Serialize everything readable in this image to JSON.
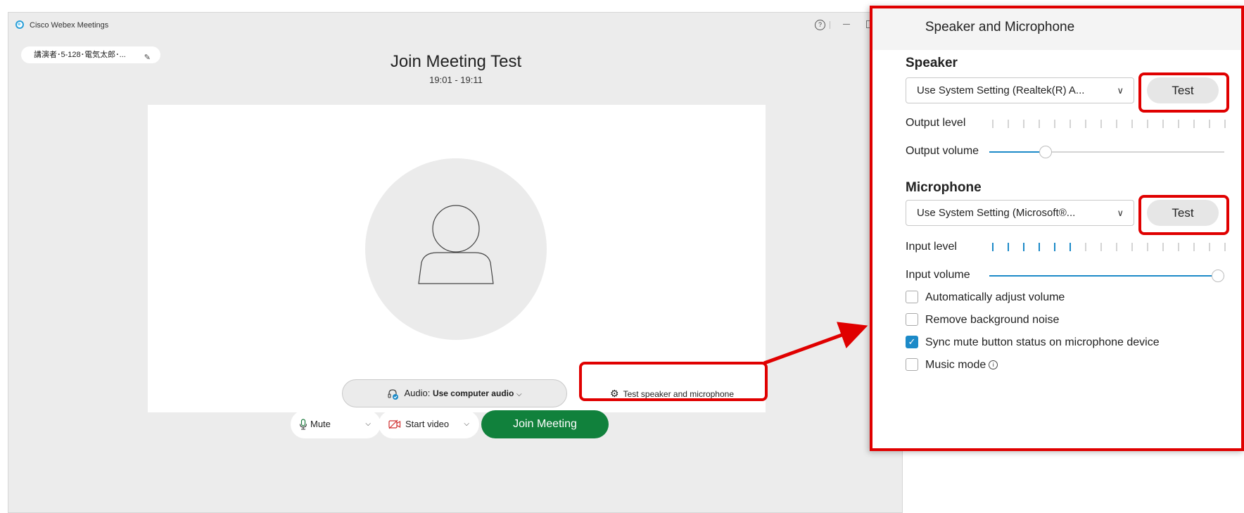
{
  "app": {
    "title": "Cisco Webex Meetings",
    "help_glyph": "?"
  },
  "profile": {
    "name": "講演者･5-128･電気太郎･..."
  },
  "meeting": {
    "title": "Join Meeting Test",
    "time": "19:01 - 19:11"
  },
  "audio": {
    "prefix": "Audio: ",
    "value": "Use computer audio",
    "chevron": "⌵"
  },
  "test_link": {
    "label": "Test speaker and microphone",
    "icon": "gear-icon"
  },
  "controls": {
    "mute_label": "Mute",
    "video_label": "Start video",
    "join_label": "Join Meeting",
    "join_color": "#11813c"
  },
  "dialog": {
    "title": "Speaker and Microphone",
    "close_glyph": "×",
    "speaker": {
      "title": "Speaker",
      "device": "Use System Setting (Realtek(R) A...",
      "test_label": "Test",
      "output_level_label": "Output level",
      "output_level_active_ticks": 0,
      "output_volume_label": "Output volume",
      "output_volume": 0.24
    },
    "microphone": {
      "title": "Microphone",
      "device": "Use System Setting (Microsoft®...",
      "test_label": "Test",
      "input_level_label": "Input level",
      "input_level_active_ticks": 6,
      "input_volume_label": "Input volume",
      "input_volume": 1.0
    },
    "options": [
      {
        "label": "Automatically adjust volume",
        "checked": false
      },
      {
        "label": "Remove background noise",
        "checked": false
      },
      {
        "label": "Sync mute button status on microphone device",
        "checked": true
      },
      {
        "label": "Music mode",
        "checked": false,
        "info_icon": true
      }
    ]
  },
  "colors": {
    "accent": "#1c8ac8",
    "annotation": "#e00000"
  }
}
